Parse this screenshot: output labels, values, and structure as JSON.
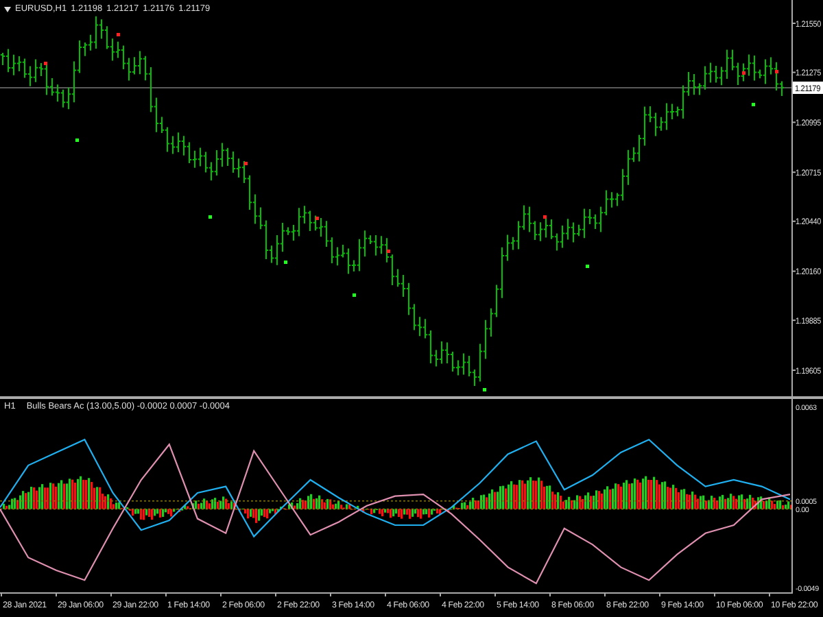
{
  "main_panel": {
    "symbol": "EURUSD,H1",
    "ohlc": [
      "1.21198",
      "1.21217",
      "1.21176",
      "1.21179"
    ],
    "price_axis": [
      "1.21550",
      "1.21275",
      "1.20995",
      "1.20715",
      "1.20440",
      "1.20160",
      "1.19885",
      "1.19605"
    ],
    "current_price": "1.21179"
  },
  "indicator_panel": {
    "timeframe": "H1",
    "title": "Bulls Bears Ac (13.00,5.00) -0.0002 0.0007 -0.0004",
    "chart_data": {
      "type": "line",
      "series": [
        {
          "color": "#20b0f0",
          "values": [
            0.0001,
            0.0027,
            0.0035,
            0.0043,
            0.001,
            -0.0013,
            -0.0007,
            0.001,
            0.0014,
            -0.0017,
            0.0001,
            0.0018,
            0.0007,
            -0.0003,
            -0.001,
            -0.001,
            0.0001,
            0.0016,
            0.0034,
            0.0042,
            0.0012,
            0.0021,
            0.0035,
            0.0043,
            0.0027,
            0.0014,
            0.0018,
            0.0014,
            0.0006
          ]
        },
        {
          "color": "#e090b0",
          "values": [
            0.0,
            -0.003,
            -0.0038,
            -0.0044,
            -0.0012,
            0.0018,
            0.004,
            -0.0006,
            -0.0015,
            0.0036,
            0.001,
            -0.0016,
            -0.0008,
            0.0002,
            0.0008,
            0.0009,
            -0.0003,
            -0.0019,
            -0.0036,
            -0.0046,
            -0.0012,
            -0.0022,
            -0.0036,
            -0.0044,
            -0.0028,
            -0.0015,
            -0.001,
            0.0006,
            0.0009
          ]
        }
      ],
      "ylim": [
        -0.0049,
        0.0063
      ],
      "yticks": [
        {
          "value": 0.0063,
          "label": "0.0063"
        },
        {
          "value": 0.0005,
          "label": "0.0005"
        },
        {
          "value": 0,
          "label": "0.00"
        },
        {
          "value": -0.0049,
          "label": "-0.0049"
        }
      ]
    }
  },
  "time_axis": [
    "28 Jan 2021",
    "29 Jan 06:00",
    "29 Jan 22:00",
    "1 Feb 14:00",
    "2 Feb 06:00",
    "2 Feb 22:00",
    "3 Feb 14:00",
    "4 Feb 06:00",
    "4 Feb 22:00",
    "5 Feb 14:00",
    "8 Feb 06:00",
    "8 Feb 22:00",
    "9 Feb 14:00",
    "10 Feb 06:00",
    "10 Feb 22:00"
  ]
}
